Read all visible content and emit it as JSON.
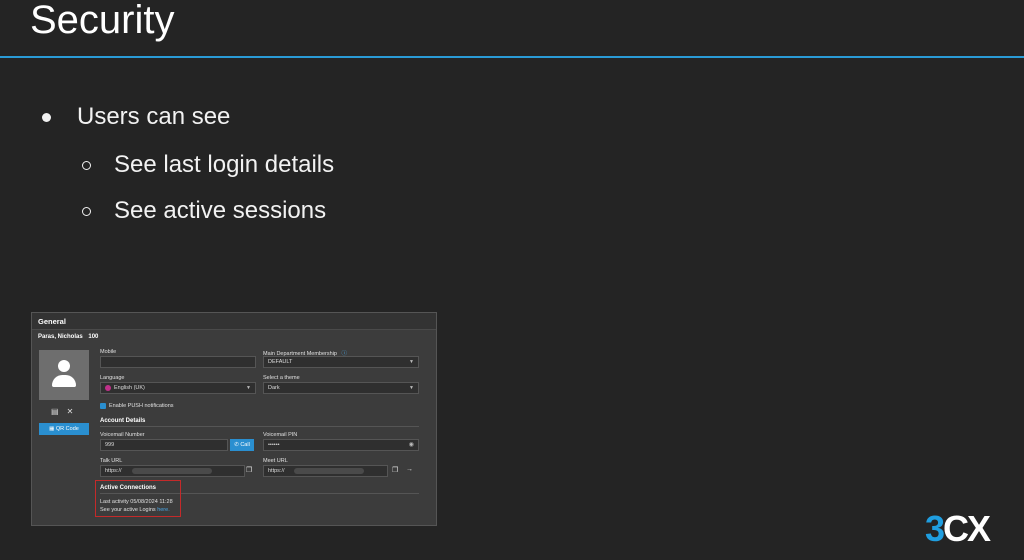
{
  "slide": {
    "title": "Security",
    "bullet": "Users can see",
    "sub_bullets": [
      "See last login details",
      "See active sessions"
    ]
  },
  "screenshot": {
    "header": "General",
    "user_name": "Paras, Nicholas",
    "extension": "100",
    "qr_button": "QR Code",
    "mobile_label": "Mobile",
    "mobile_value": "",
    "dept_label": "Main Department Membership",
    "dept_value": "DEFAULT",
    "language_label": "Language",
    "language_value": "English (UK)",
    "theme_label": "Select a theme",
    "theme_value": "Dark",
    "push_label": "Enable PUSH notifications",
    "account_section": "Account Details",
    "voicemail_number_label": "Voicemail Number",
    "voicemail_number_value": "999",
    "call_button": "Call",
    "voicemail_pin_label": "Voicemail PIN",
    "voicemail_pin_value": "••••••",
    "talk_url_label": "Talk URL",
    "talk_url_value": "https://",
    "meet_url_label": "Meet URL",
    "meet_url_value": "https://",
    "active_section": "Active Connections",
    "last_activity": "Last activity 05/08/2024 11:28",
    "active_logins_text": "See your active Logins",
    "active_logins_link": "here."
  },
  "logo": {
    "part1": "3",
    "part2": "CX"
  },
  "colors": {
    "accent": "#2a9bd6",
    "highlight": "#c42a2a",
    "button": "#2a8fd0"
  }
}
